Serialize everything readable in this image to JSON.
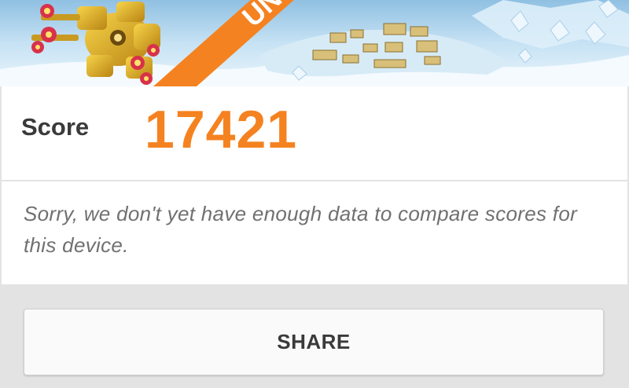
{
  "banner": {
    "ribbon_text": "UN",
    "accent_color": "#f58220"
  },
  "score": {
    "label": "Score",
    "value": "17421",
    "value_color": "#f58220"
  },
  "message": {
    "text": "Sorry, we don't yet have enough data to compare scores for this device."
  },
  "actions": {
    "share_label": "SHARE"
  }
}
